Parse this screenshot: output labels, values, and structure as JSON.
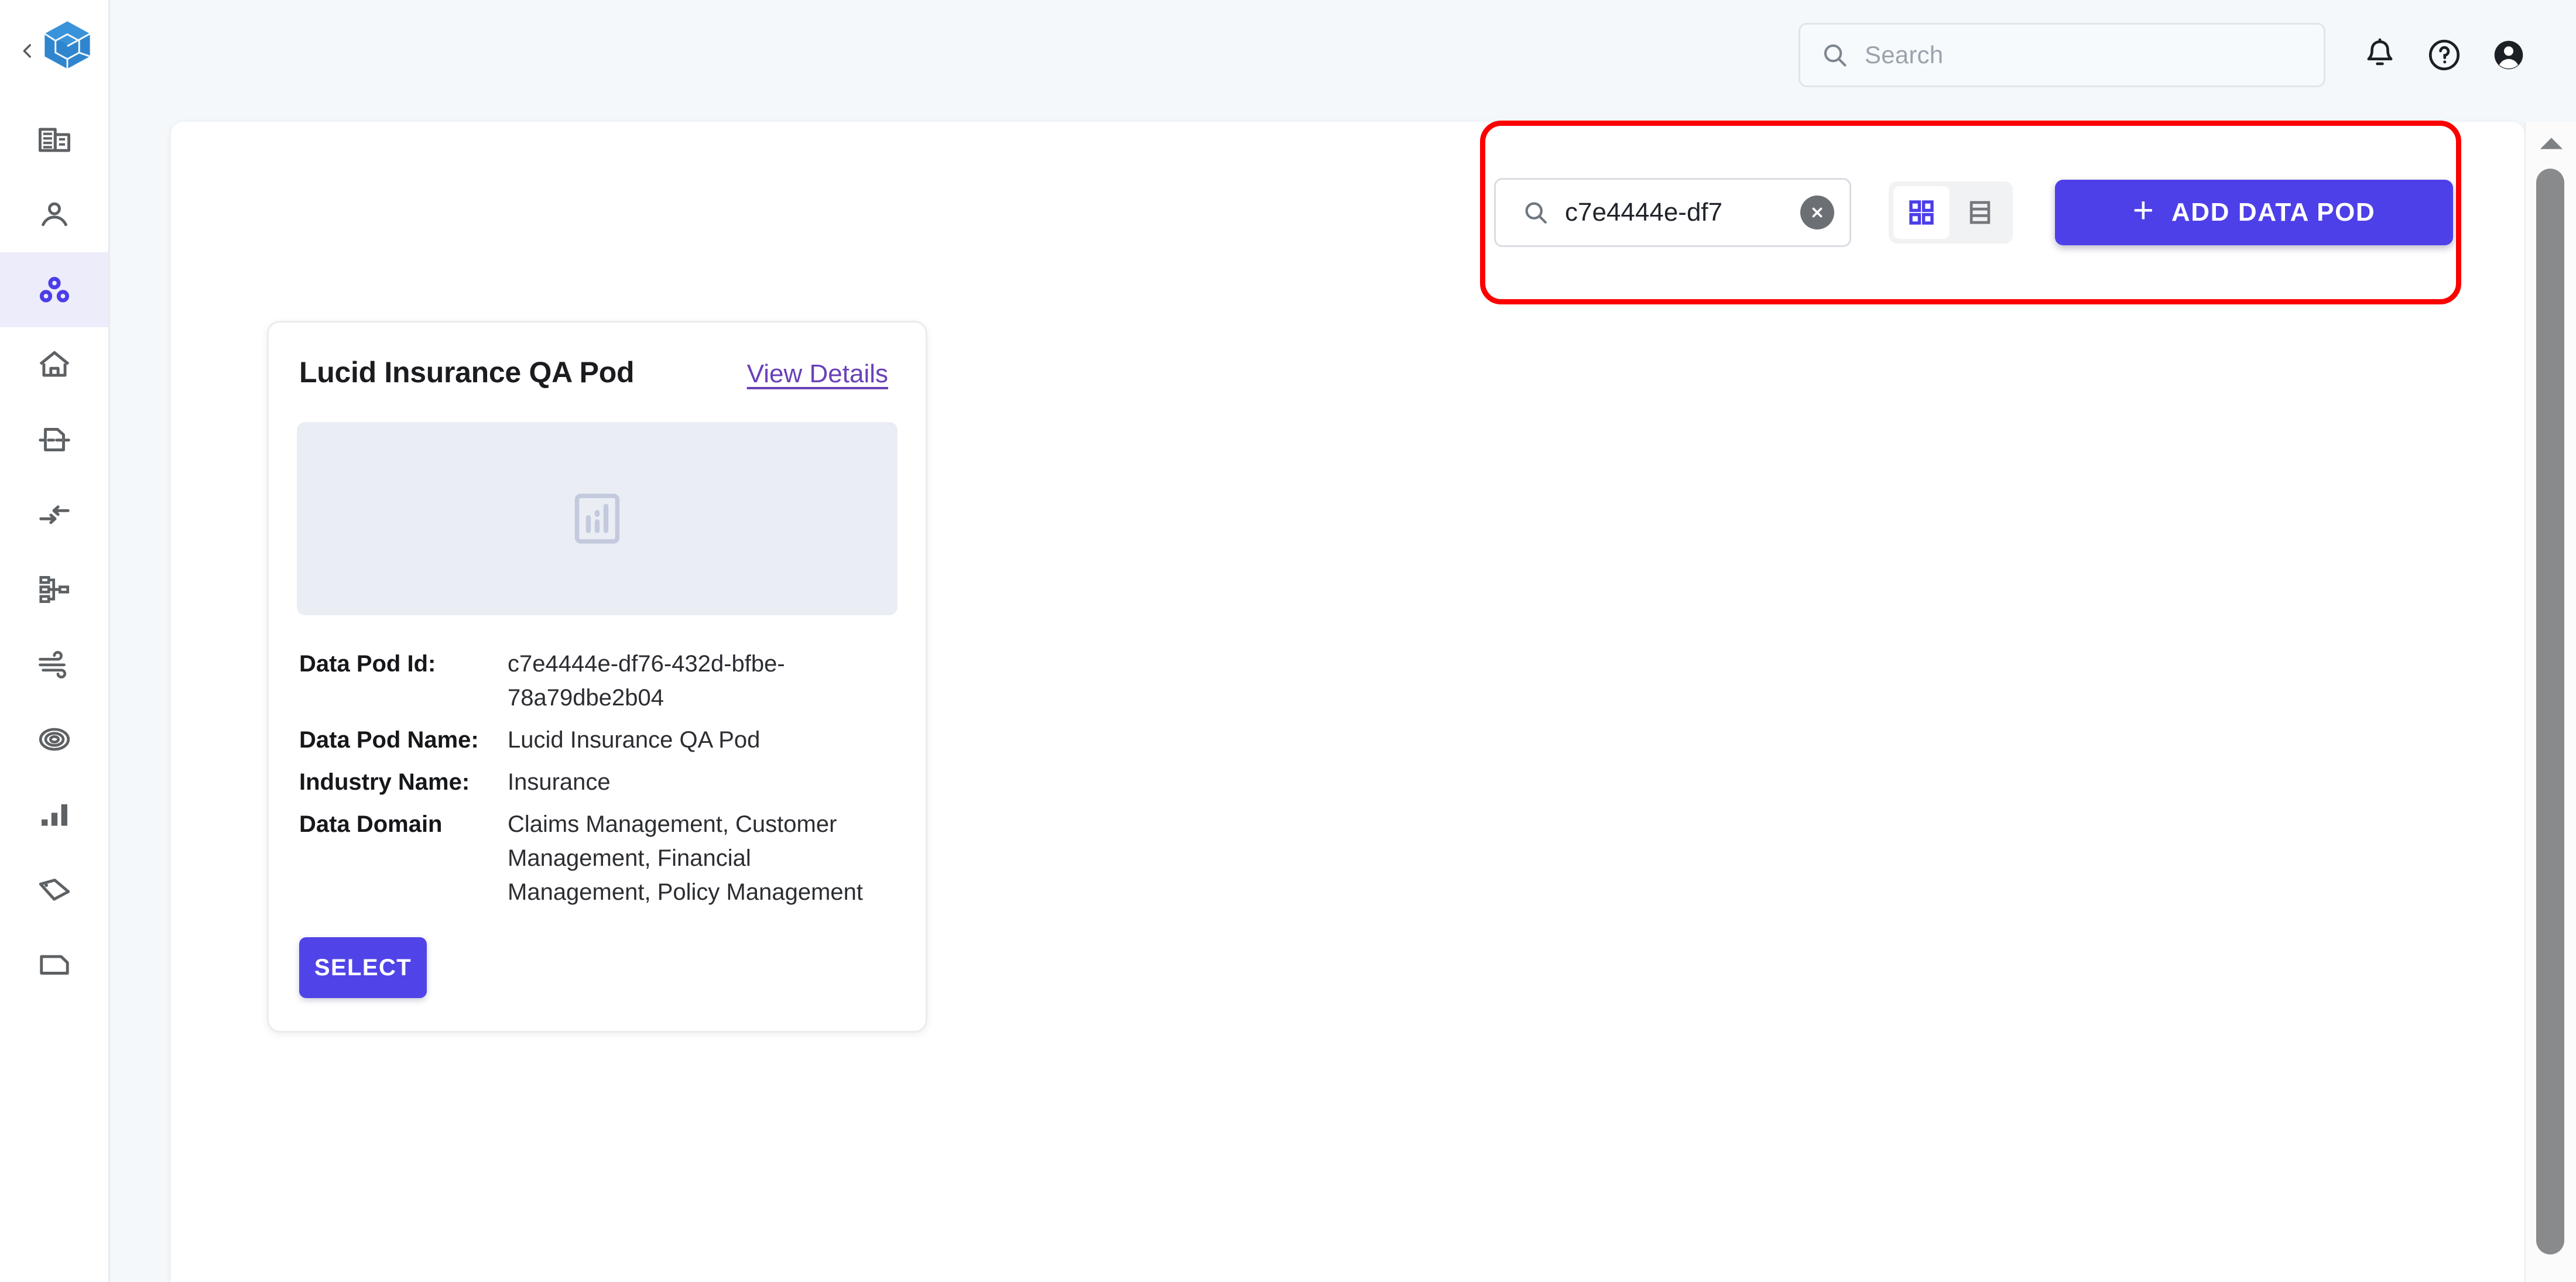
{
  "colors": {
    "accent": "#4d40e8",
    "accent_select": "#5044e8",
    "link": "#6941b8",
    "annotation": "#fc0000",
    "sidebar_active_bg": "#edecfa",
    "page_bg": "#f4f8fb",
    "logo_blue": "#2f86cf"
  },
  "sidebar": {
    "collapse_icon": "chevron-left-icon",
    "logo_icon": "cube-logo-icon",
    "items": [
      {
        "name": "sidebar-item-organization",
        "icon": "building-icon",
        "active": false
      },
      {
        "name": "sidebar-item-user",
        "icon": "person-icon",
        "active": false
      },
      {
        "name": "sidebar-item-data-pods",
        "icon": "data-pods-icon",
        "active": true
      },
      {
        "name": "sidebar-item-home",
        "icon": "home-icon",
        "active": false
      },
      {
        "name": "sidebar-item-data-source",
        "icon": "document-split-icon",
        "active": false
      },
      {
        "name": "sidebar-item-transfer",
        "icon": "arrows-exchange-icon",
        "active": false
      },
      {
        "name": "sidebar-item-lineage",
        "icon": "hierarchy-icon",
        "active": false
      },
      {
        "name": "sidebar-item-pipeline",
        "icon": "wind-flow-icon",
        "active": false
      },
      {
        "name": "sidebar-item-target",
        "icon": "target-spiral-icon",
        "active": false
      },
      {
        "name": "sidebar-item-analytics",
        "icon": "bar-chart-icon",
        "active": false
      },
      {
        "name": "sidebar-item-tags",
        "icon": "tag-icon",
        "active": false
      },
      {
        "name": "sidebar-item-reports",
        "icon": "file-icon",
        "active": false
      }
    ]
  },
  "topbar": {
    "search": {
      "icon": "search-icon",
      "placeholder": "Search",
      "value": ""
    },
    "notifications_icon": "bell-icon",
    "help_icon": "help-circle-icon",
    "account_icon": "account-circle-icon"
  },
  "toolbar": {
    "search": {
      "icon": "search-icon",
      "value": "c7e4444e-df7",
      "placeholder": "Search",
      "clear_icon": "clear-circle-icon"
    },
    "view_toggle": {
      "grid_icon": "grid-view-icon",
      "list_icon": "list-view-icon",
      "active": "grid"
    },
    "add_button": {
      "plus": "+",
      "label": "ADD DATA POD",
      "icon": "plus-icon"
    }
  },
  "pod_card": {
    "title": "Lucid Insurance QA Pod",
    "view_details_label": "View Details",
    "thumbnail_icon": "bar-chart-placeholder-icon",
    "fields": [
      {
        "key": "Data Pod Id:",
        "value": "c7e4444e-df76-432d-bfbe-78a79dbe2b04"
      },
      {
        "key": "Data Pod Name:",
        "value": "Lucid Insurance QA Pod"
      },
      {
        "key": "Industry Name:",
        "value": "Insurance"
      },
      {
        "key": "Data Domain",
        "value": "Claims Management, Customer Management, Financial Management, Policy Management"
      }
    ],
    "select_label": "SELECT"
  },
  "scrollbar": {
    "up_arrow_icon": "scroll-up-arrow-icon",
    "thumb": "scrollbar-thumb"
  }
}
